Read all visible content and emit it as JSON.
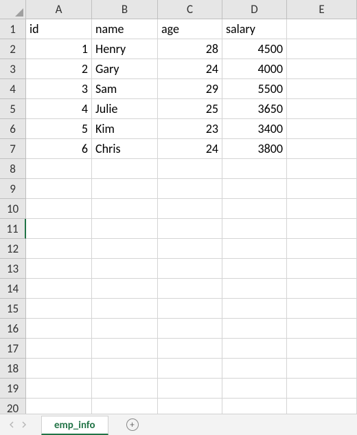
{
  "columns": [
    "A",
    "B",
    "C",
    "D",
    "E"
  ],
  "visible_rows": 20,
  "selected_row": 11,
  "headers": {
    "A": "id",
    "B": "name",
    "C": "age",
    "D": "salary"
  },
  "data_rows": [
    {
      "id": 1,
      "name": "Henry",
      "age": 28,
      "salary": 4500
    },
    {
      "id": 2,
      "name": "Gary",
      "age": 24,
      "salary": 4000
    },
    {
      "id": 3,
      "name": "Sam",
      "age": 29,
      "salary": 5500
    },
    {
      "id": 4,
      "name": "Julie",
      "age": 25,
      "salary": 3650
    },
    {
      "id": 5,
      "name": "Kim",
      "age": 23,
      "salary": 3400
    },
    {
      "id": 6,
      "name": "Chris",
      "age": 24,
      "salary": 3800
    }
  ],
  "sheet_tab": {
    "name": "emp_info"
  },
  "chart_data": {
    "type": "table",
    "columns": [
      "id",
      "name",
      "age",
      "salary"
    ],
    "rows": [
      [
        1,
        "Henry",
        28,
        4500
      ],
      [
        2,
        "Gary",
        24,
        4000
      ],
      [
        3,
        "Sam",
        29,
        5500
      ],
      [
        4,
        "Julie",
        25,
        3650
      ],
      [
        5,
        "Kim",
        23,
        3400
      ],
      [
        6,
        "Chris",
        24,
        3800
      ]
    ]
  }
}
